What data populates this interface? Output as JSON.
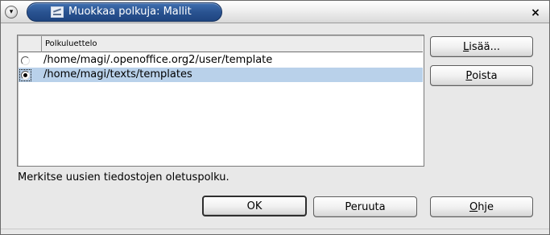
{
  "window": {
    "title": "Muokkaa polkuja: Mallit",
    "menu_glyph": "▾",
    "close_glyph": "×",
    "icons": {
      "menu": "window-menu-icon",
      "app": "path-edit-icon",
      "close": "close-icon"
    }
  },
  "list": {
    "header_label": "Polkuluettelo",
    "rows": [
      {
        "path": "/home/magi/.openoffice.org2/user/template",
        "checked": false,
        "selected": false
      },
      {
        "path": "/home/magi/texts/templates",
        "checked": true,
        "selected": true
      }
    ]
  },
  "side_buttons": {
    "add": {
      "mnemonic": "L",
      "rest": "isää..."
    },
    "remove": {
      "mnemonic": "P",
      "rest": "oista"
    }
  },
  "hint_text": "Merkitse uusien tiedostojen oletuspolku.",
  "footer_buttons": {
    "ok": "OK",
    "cancel": "Peruuta",
    "help": {
      "mnemonic": "O",
      "rest": "hje"
    }
  },
  "colors": {
    "title_bar_accent": "#2a5391",
    "selection": "#b9d1ea",
    "dialog_background": "#e8e8e8"
  }
}
